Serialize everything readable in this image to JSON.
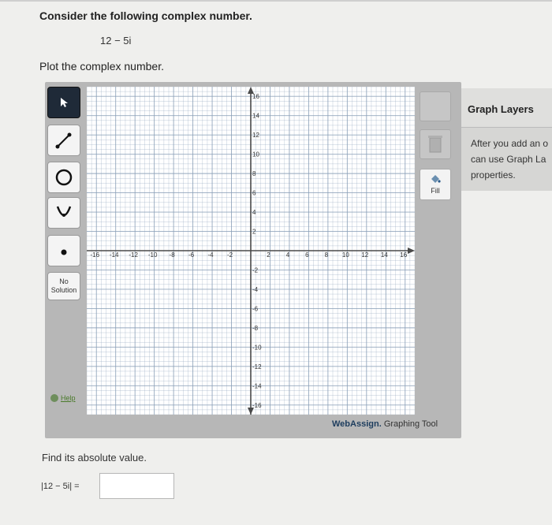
{
  "question": {
    "title": "Consider the following complex number.",
    "number": "12 − 5i",
    "prompt": "Plot the complex number."
  },
  "graph_tool": {
    "tools": [
      {
        "name": "pointer",
        "icon": "arrow-cursor-icon",
        "active": true
      },
      {
        "name": "line",
        "icon": "line-tool-icon",
        "active": false
      },
      {
        "name": "circle",
        "icon": "circle-tool-icon",
        "active": false
      },
      {
        "name": "parabola",
        "icon": "parabola-tool-icon",
        "active": false
      },
      {
        "name": "point",
        "icon": "point-tool-icon",
        "active": false
      }
    ],
    "no_solution_label": "No Solution",
    "help_label": "Help",
    "fill_label": "Fill",
    "brand_name": "WebAssign.",
    "brand_suffix": "Graphing Tool",
    "x_ticks": [
      "-16",
      "-14",
      "-12",
      "-10",
      "-8",
      "-6",
      "-4",
      "-2",
      "2",
      "4",
      "6",
      "8",
      "10",
      "12",
      "14",
      "16"
    ],
    "y_ticks": [
      "16",
      "14",
      "12",
      "10",
      "8",
      "6",
      "4",
      "2",
      "-2",
      "-4",
      "-6",
      "-8",
      "-10",
      "-12",
      "-14",
      "-16"
    ],
    "x_range": [
      -17,
      17
    ],
    "y_range": [
      -17,
      17
    ]
  },
  "layers_panel": {
    "title": "Graph Layers",
    "text": "After you add an o\ncan use Graph La\nproperties."
  },
  "absolute_value": {
    "prompt": "Find its absolute value.",
    "label": "|12 − 5i| =",
    "value": ""
  },
  "colors": {
    "active_tool": "#1f2a38",
    "frame": "#bdbdbd",
    "axis": "#4a4a4a",
    "grid": "#8a9fb8"
  }
}
